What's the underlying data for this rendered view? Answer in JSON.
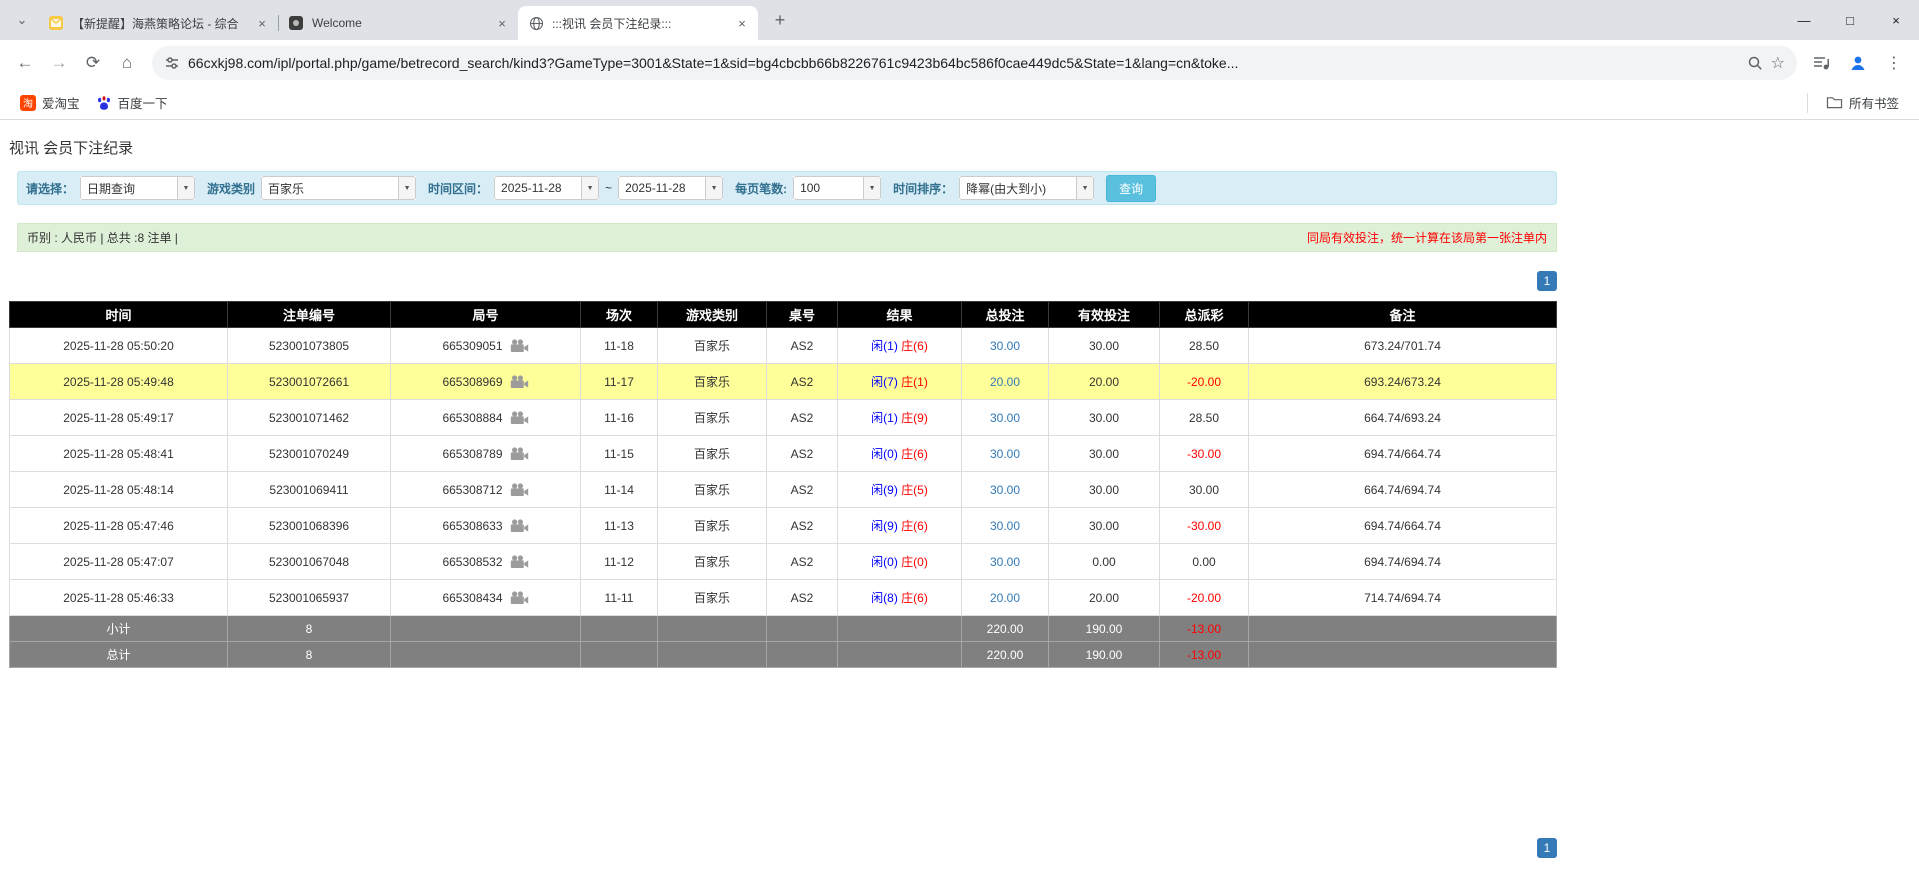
{
  "browser": {
    "tabs": [
      {
        "title": "【新提醒】海燕策略论坛 - 综合"
      },
      {
        "title": "Welcome"
      },
      {
        "title": ":::视讯 会员下注纪录:::"
      }
    ],
    "url": "66cxkj98.com/ipl/portal.php/game/betrecord_search/kind3?GameType=3001&State=1&sid=bg4cbcbb66b8226761c9423b64bc586f0cae449dc5&State=1&lang=cn&toke...",
    "bookmarks": {
      "item1": "爱淘宝",
      "item2": "百度一下",
      "all_label": "所有书签"
    }
  },
  "icons": {
    "tab_search": "⌄",
    "close": "×",
    "new_tab": "+",
    "minimize": "—",
    "maximize": "□",
    "window_close": "×",
    "back": "←",
    "forward": "→",
    "reload": "⟳",
    "home": "⌂",
    "star": "☆",
    "menu": "⋮",
    "caret_down": "▼",
    "taobao_glyph": "淘"
  },
  "page": {
    "title": "视讯 会员下注纪录",
    "filter": {
      "select_label": "请选择：",
      "select_value": "日期查询",
      "game_type_label": "游戏类别",
      "game_type_value": "百家乐",
      "date_range_label": "时间区间：",
      "date_from": "2025-11-28",
      "tilde": "~",
      "date_to": "2025-11-28",
      "page_size_label": "每页笔数:",
      "page_size_value": "100",
      "sort_label": "时间排序：",
      "sort_value": "降幂(由大到小)",
      "search_button": "查询"
    },
    "info_bar": {
      "left": "币别 : 人民币 | 总共 :8 注单 |",
      "right": "同局有效投注，统一计算在该局第一张注单内"
    },
    "pagination": {
      "top": "1",
      "bottom": "1"
    },
    "colors": {
      "highlight_row": "#ffff99",
      "accent_blue": "#337ab7",
      "negative_red": "#ff0000",
      "result_player_blue": "#0000ff",
      "result_banker_red": "#ff0000"
    },
    "table": {
      "headers": [
        "时间",
        "注单编号",
        "局号",
        "场次",
        "游戏类别",
        "桌号",
        "结果",
        "总投注",
        "有效投注",
        "总派彩",
        "备注"
      ],
      "rows": [
        {
          "time": "2025-11-28 05:50:20",
          "bet_id": "523001073805",
          "round_id": "665309051",
          "session": "11-18",
          "game": "百家乐",
          "table": "AS2",
          "result_xian": "闲(1)",
          "result_zhuang": "庄(6)",
          "total_bet": "30.00",
          "valid_bet": "30.00",
          "payout": "28.50",
          "note": "673.24/701.74",
          "highlight": false
        },
        {
          "time": "2025-11-28 05:49:48",
          "bet_id": "523001072661",
          "round_id": "665308969",
          "session": "11-17",
          "game": "百家乐",
          "table": "AS2",
          "result_xian": "闲(7)",
          "result_zhuang": "庄(1)",
          "total_bet": "20.00",
          "valid_bet": "20.00",
          "payout": "-20.00",
          "note": "693.24/673.24",
          "highlight": true
        },
        {
          "time": "2025-11-28 05:49:17",
          "bet_id": "523001071462",
          "round_id": "665308884",
          "session": "11-16",
          "game": "百家乐",
          "table": "AS2",
          "result_xian": "闲(1)",
          "result_zhuang": "庄(9)",
          "total_bet": "30.00",
          "valid_bet": "30.00",
          "payout": "28.50",
          "note": "664.74/693.24",
          "highlight": false
        },
        {
          "time": "2025-11-28 05:48:41",
          "bet_id": "523001070249",
          "round_id": "665308789",
          "session": "11-15",
          "game": "百家乐",
          "table": "AS2",
          "result_xian": "闲(0)",
          "result_zhuang": "庄(6)",
          "total_bet": "30.00",
          "valid_bet": "30.00",
          "payout": "-30.00",
          "note": "694.74/664.74",
          "highlight": false
        },
        {
          "time": "2025-11-28 05:48:14",
          "bet_id": "523001069411",
          "round_id": "665308712",
          "session": "11-14",
          "game": "百家乐",
          "table": "AS2",
          "result_xian": "闲(9)",
          "result_zhuang": "庄(5)",
          "total_bet": "30.00",
          "valid_bet": "30.00",
          "payout": "30.00",
          "note": "664.74/694.74",
          "highlight": false
        },
        {
          "time": "2025-11-28 05:47:46",
          "bet_id": "523001068396",
          "round_id": "665308633",
          "session": "11-13",
          "game": "百家乐",
          "table": "AS2",
          "result_xian": "闲(9)",
          "result_zhuang": "庄(6)",
          "total_bet": "30.00",
          "valid_bet": "30.00",
          "payout": "-30.00",
          "note": "694.74/664.74",
          "highlight": false
        },
        {
          "time": "2025-11-28 05:47:07",
          "bet_id": "523001067048",
          "round_id": "665308532",
          "session": "11-12",
          "game": "百家乐",
          "table": "AS2",
          "result_xian": "闲(0)",
          "result_zhuang": "庄(0)",
          "total_bet": "30.00",
          "valid_bet": "0.00",
          "payout": "0.00",
          "note": "694.74/694.74",
          "highlight": false
        },
        {
          "time": "2025-11-28 05:46:33",
          "bet_id": "523001065937",
          "round_id": "665308434",
          "session": "11-11",
          "game": "百家乐",
          "table": "AS2",
          "result_xian": "闲(8)",
          "result_zhuang": "庄(6)",
          "total_bet": "20.00",
          "valid_bet": "20.00",
          "payout": "-20.00",
          "note": "714.74/694.74",
          "highlight": false
        }
      ],
      "summary": [
        {
          "label": "小计",
          "count": "8",
          "total_bet": "220.00",
          "valid_bet": "190.00",
          "payout": "-13.00"
        },
        {
          "label": "总计",
          "count": "8",
          "total_bet": "220.00",
          "valid_bet": "190.00",
          "payout": "-13.00"
        }
      ]
    }
  }
}
